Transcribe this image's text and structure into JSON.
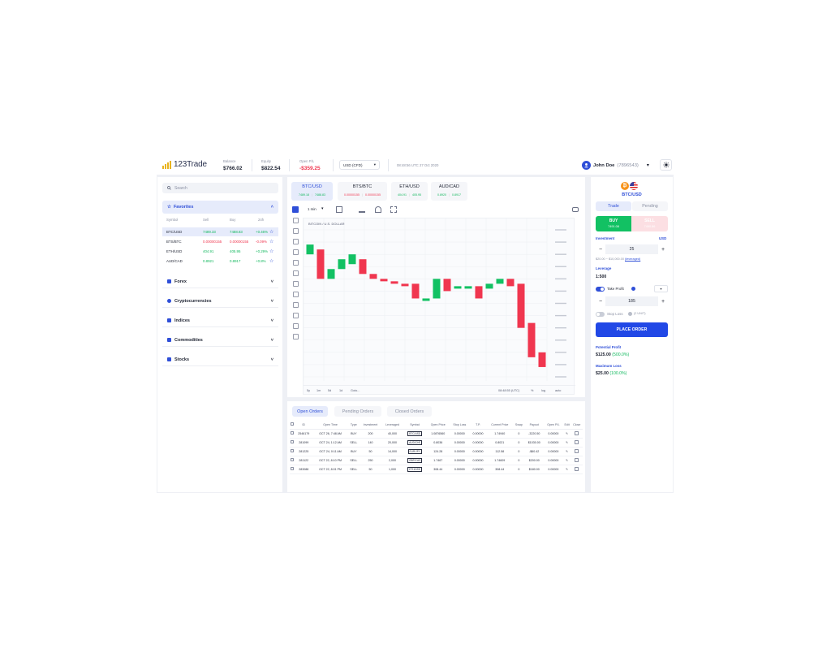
{
  "header": {
    "logo": "123Trade",
    "balance_label": "Balance",
    "balance_value": "$766.02",
    "equity_label": "Equity",
    "equity_value": "$822.54",
    "openpl_label": "Open P/L",
    "openpl_value": "-$359.25",
    "currency": "USD (CFD)",
    "datetime": "08:48:56 UTC 27 Oct 2020",
    "user_name": "John Doe",
    "user_id": "(7896543)"
  },
  "sidebar": {
    "search_placeholder": "Search",
    "favorites_label": "Favorites",
    "columns": [
      "Symbol",
      "Sell",
      "Buy",
      "24h"
    ],
    "favorites": [
      {
        "symbol": "BTC/USD",
        "sell": "7489.33",
        "buy": "7488.83",
        "change": "+0.46%"
      },
      {
        "symbol": "BTS/BTC",
        "sell": "0.00000155",
        "buy": "0.00000155",
        "change": "-0.09%"
      },
      {
        "symbol": "ETH/USD",
        "sell": "404.91",
        "buy": "405.95",
        "change": "+0.29%"
      },
      {
        "symbol": "AUD/CAD",
        "sell": "0.8921",
        "buy": "0.8917",
        "change": "+0.8%"
      }
    ],
    "categories": [
      "Forex",
      "Cryptocurrencies",
      "Indices",
      "Commodities",
      "Stocks"
    ]
  },
  "chart_panel": {
    "pairs": [
      {
        "name": "BTC/USD",
        "p1": "7489.18",
        "p2": "7488.83"
      },
      {
        "name": "BTS/BTC",
        "p1": "0.00000155",
        "p2": "0.00000155"
      },
      {
        "name": "ETH/USD",
        "p1": "404.91",
        "p2": "405.95"
      },
      {
        "name": "AUD/CAD",
        "p1": "0.8920",
        "p2": "0.8917"
      }
    ],
    "interval": "1 min",
    "chart_title": "BITCOIN / U.S. DOLLAR",
    "ranges": [
      "5y",
      "1m",
      "5d",
      "1d",
      "Goto..."
    ],
    "bottom_right": [
      "08:48:55 (UTC)",
      "%",
      "log",
      "auto"
    ]
  },
  "chart_data": {
    "type": "candlestick",
    "title": "BITCOIN / U.S. DOLLAR",
    "candles": [
      {
        "open": 7485,
        "close": 7487,
        "dir": "up"
      },
      {
        "open": 7486,
        "close": 7480,
        "dir": "down"
      },
      {
        "open": 7480,
        "close": 7482,
        "dir": "up"
      },
      {
        "open": 7482,
        "close": 7484,
        "dir": "up"
      },
      {
        "open": 7485,
        "close": 7483,
        "dir": "up"
      },
      {
        "open": 7484,
        "close": 7481,
        "dir": "down"
      },
      {
        "open": 7481,
        "close": 7480,
        "dir": "down"
      },
      {
        "open": 7480,
        "close": 7479.5,
        "dir": "down"
      },
      {
        "open": 7479.5,
        "close": 7479,
        "dir": "down"
      },
      {
        "open": 7479,
        "close": 7478.5,
        "dir": "down"
      },
      {
        "open": 7479,
        "close": 7476,
        "dir": "down"
      },
      {
        "open": 7476,
        "close": 7475.5,
        "dir": "up"
      },
      {
        "open": 7476,
        "close": 7480,
        "dir": "up"
      },
      {
        "open": 7480,
        "close": 7477.5,
        "dir": "down"
      },
      {
        "open": 7478,
        "close": 7478.5,
        "dir": "up"
      },
      {
        "open": 7478,
        "close": 7478.5,
        "dir": "up"
      },
      {
        "open": 7478.5,
        "close": 7476,
        "dir": "down"
      },
      {
        "open": 7478,
        "close": 7479,
        "dir": "up"
      },
      {
        "open": 7479,
        "close": 7480,
        "dir": "up"
      },
      {
        "open": 7480,
        "close": 7478.5,
        "dir": "down"
      },
      {
        "open": 7479,
        "close": 7470,
        "dir": "down"
      },
      {
        "open": 7471,
        "close": 7464,
        "dir": "down"
      },
      {
        "open": 7465,
        "close": 7462,
        "dir": "down"
      }
    ],
    "ylim": [
      7460,
      7490
    ],
    "grid": true
  },
  "orders": {
    "tabs": [
      "Open Orders",
      "Pending Orders",
      "Closed Orders"
    ],
    "columns": [
      "ID",
      "Open Time",
      "Type",
      "Investment",
      "Leveraged",
      "Symbol",
      "Open Price",
      "Stop Loss",
      "T.P.",
      "Current Price",
      "Swap",
      "Payout",
      "Open P/L",
      "Edit",
      "Close"
    ],
    "rows": [
      [
        "2546179",
        "OCT 26, 7:48 AM",
        "BUY",
        "200",
        "40,000",
        "BTC/USD",
        "1.0876560",
        "0.00000",
        "0.00000",
        "1.74940",
        "0",
        "-3220.50",
        "0.00000"
      ],
      [
        "281099",
        "OCT 24, 1:12 AM",
        "SELL",
        "140",
        "20,000",
        "AUD/CHF",
        "0.8036",
        "0.00000",
        "0.00000",
        "0.8021",
        "0",
        "$1030.00",
        "0.00000"
      ],
      [
        "281225",
        "OCT 24, 0:11 AM",
        "BUY",
        "50",
        "14,000",
        "EUR/JPY",
        "124.28",
        "0.00000",
        "0.00000",
        "112.58",
        "0",
        "-$60.42",
        "0.00000"
      ],
      [
        "281122",
        "OCT 22, 8:10 PM",
        "SELL",
        "250",
        "2,000",
        "GBP/CAD",
        "1.7467",
        "0.00000",
        "0.00000",
        "1.74609",
        "0",
        "$200.00",
        "0.00000"
      ],
      [
        "283088",
        "OCT 22, 8:01 PM",
        "SELL",
        "50",
        "1,000",
        "ETH/USD",
        "308.44",
        "0.00000",
        "0.00000",
        "308.44",
        "0",
        "$180.00",
        "0.00000"
      ]
    ]
  },
  "trade_panel": {
    "pair": "BTC/USD",
    "tabs": [
      "Trade",
      "Pending"
    ],
    "buy_label": "BUY",
    "buy_price": "7491.08",
    "sell_label": "SELL",
    "sell_price": "7490.86",
    "investment_label": "Investment",
    "investment_currency": "USD",
    "investment_value": "25",
    "investment_range": "$20.00 ~ $10,000.00",
    "investment_link": "(leveraged)",
    "leverage_label": "Leverage",
    "leverage_value": "1:500",
    "take_profit_label": "Take Profit",
    "take_profit_value": "185",
    "stop_loss_label": "Stop Loss",
    "stop_loss_hint": "(2 UNIT)",
    "place_order": "PLACE ORDER",
    "potential_profit_label": "Potential Profit",
    "potential_profit": "$125.00",
    "potential_profit_pct": "(500.0%)",
    "max_loss_label": "Maximum Loss",
    "max_loss": "$25.00",
    "max_loss_pct": "(100.0%)"
  },
  "colors": {
    "accent": "#2f4fd8",
    "up": "#12c163",
    "down": "#f0364f",
    "logo": "#e8b31f"
  }
}
